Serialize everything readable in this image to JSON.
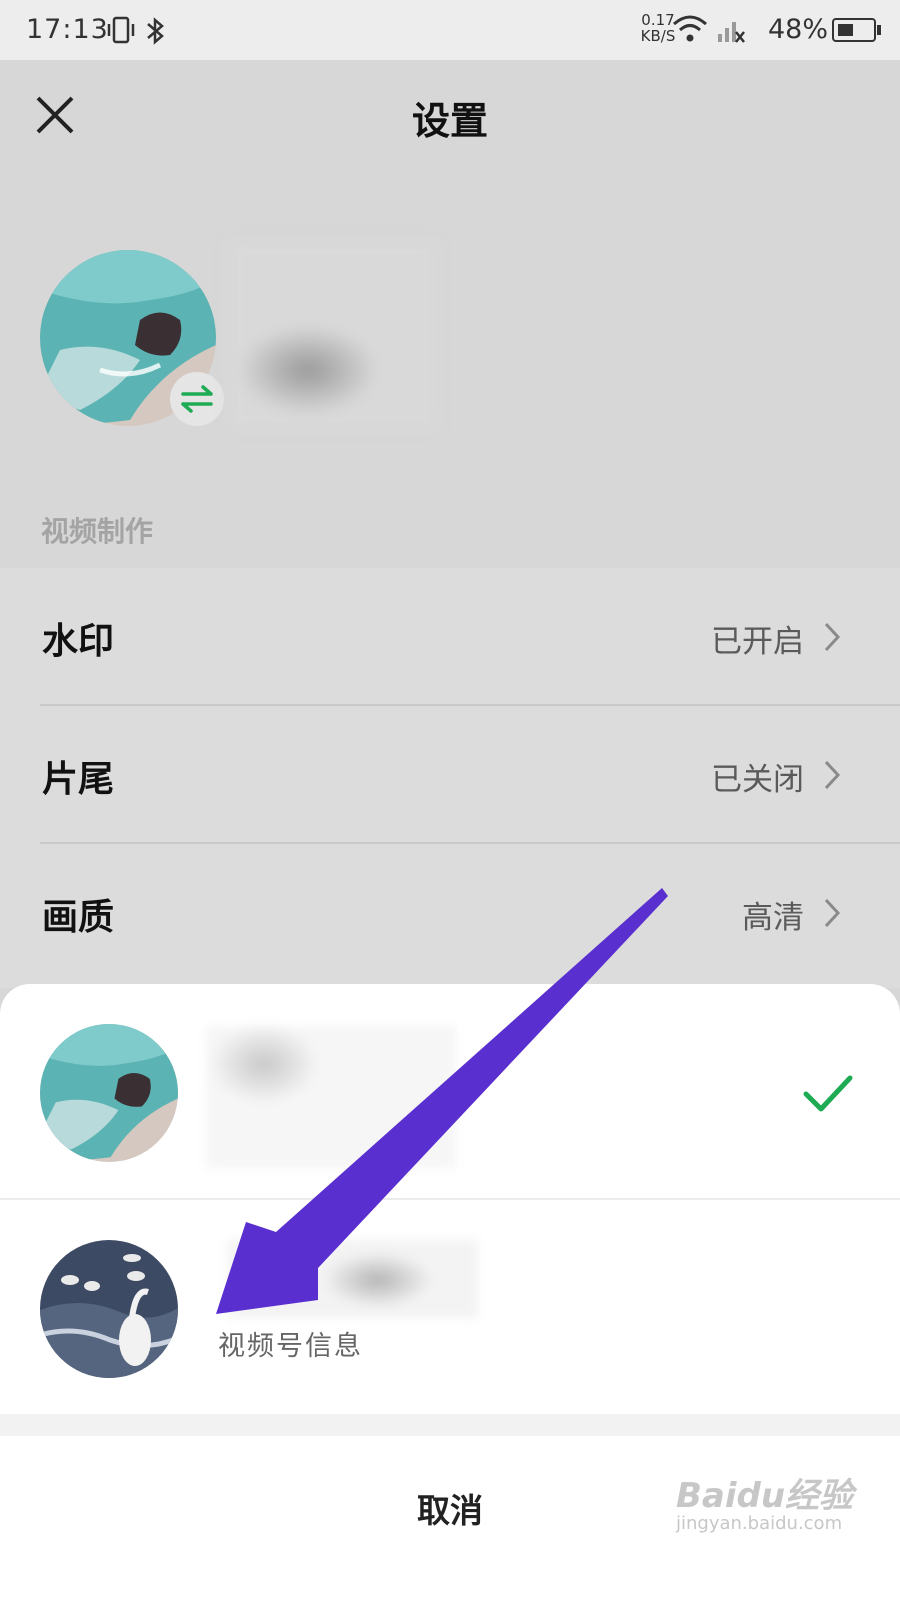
{
  "status_bar": {
    "time": "17:13",
    "speed_value": "0.17",
    "speed_unit": "KB/S",
    "battery": "48%",
    "battery_level": 0.48
  },
  "header": {
    "title": "设置"
  },
  "section": {
    "label": "视频制作"
  },
  "rows": [
    {
      "label": "水印",
      "value": "已开启"
    },
    {
      "label": "片尾",
      "value": "已关闭"
    },
    {
      "label": "画质",
      "value": "高清"
    }
  ],
  "sheet": {
    "second_account_subtitle": "视频号信息",
    "cancel_label": "取消"
  },
  "colors": {
    "accent_green": "#1fab54",
    "arrow_purple": "#5a2fd0"
  },
  "watermark": {
    "brand": "Baidu经验",
    "url": "jingyan.baidu.com"
  }
}
